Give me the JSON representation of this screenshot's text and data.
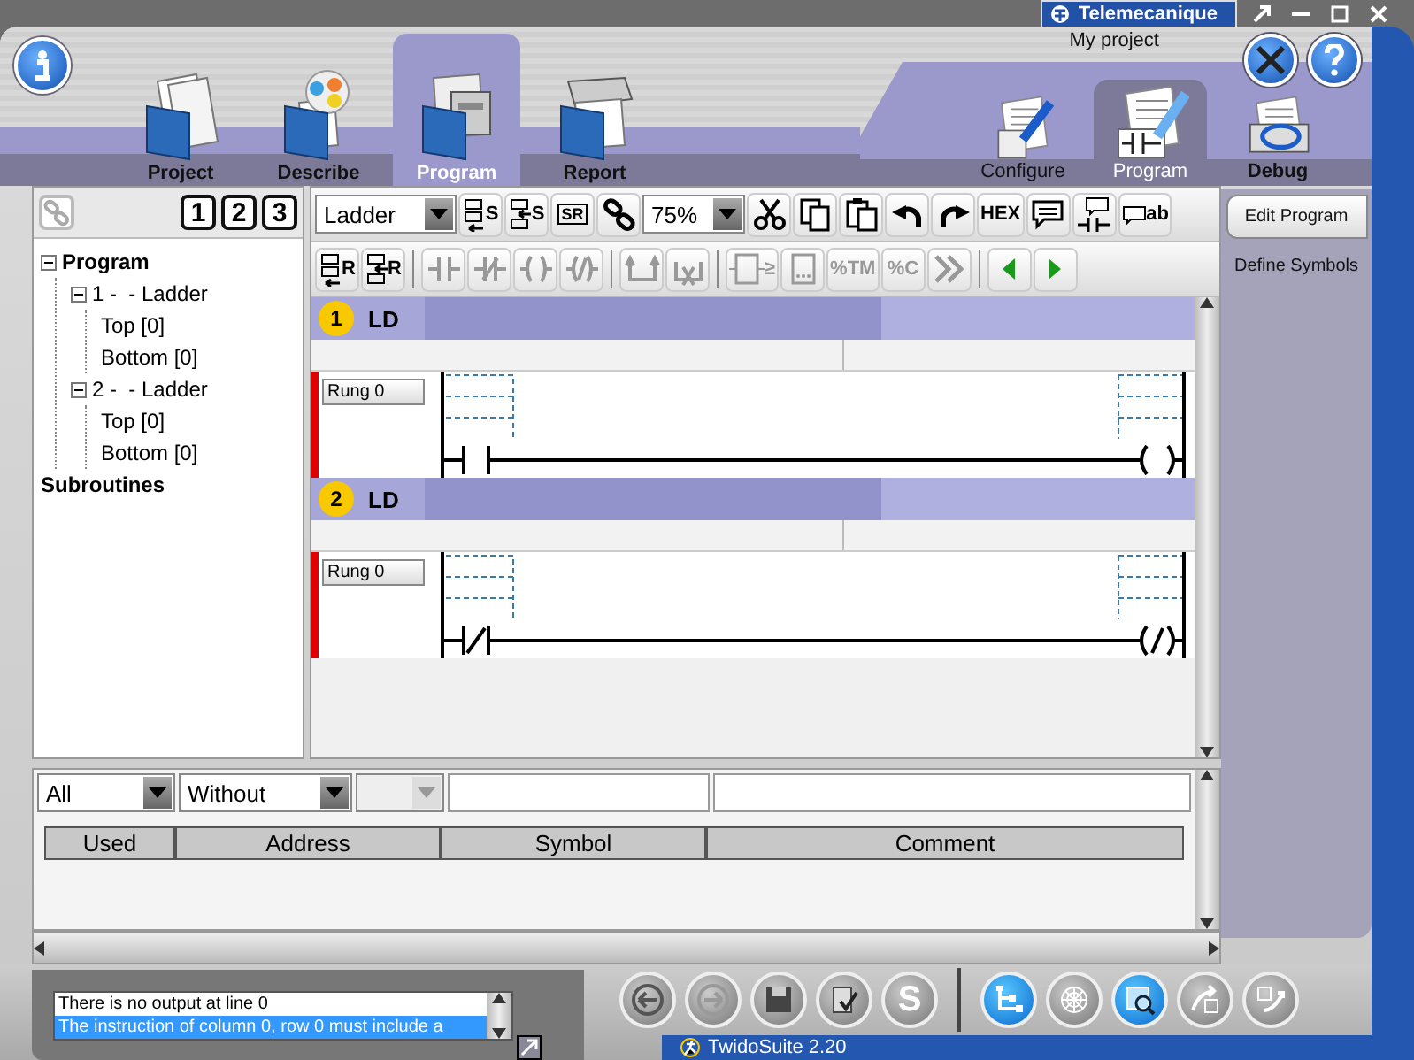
{
  "window": {
    "brand": "Telemecanique",
    "project": "My project",
    "status": "TwidoSuite 2.20"
  },
  "main_tabs": [
    {
      "label": "Project",
      "kind": "project",
      "selected": false
    },
    {
      "label": "Describe",
      "kind": "describe",
      "selected": false
    },
    {
      "label": "Program",
      "kind": "program",
      "selected": true
    },
    {
      "label": "Report",
      "kind": "report",
      "selected": false
    }
  ],
  "sub_tabs": [
    {
      "label": "Configure",
      "kind": "configure",
      "selected": false
    },
    {
      "label": "Program",
      "kind": "program",
      "selected": true
    },
    {
      "label": "Debug",
      "kind": "debug",
      "selected": false
    }
  ],
  "tree_toolbar": {
    "levels": [
      "1",
      "2",
      "3"
    ]
  },
  "tree": [
    {
      "label": "Program",
      "children": [
        {
          "label": "1 -  - Ladder",
          "children": [
            {
              "label": "Top [0]"
            },
            {
              "label": "Bottom [0]"
            }
          ]
        },
        {
          "label": "2 -  - Ladder",
          "children": [
            {
              "label": "Top [0]"
            },
            {
              "label": "Bottom [0]"
            }
          ]
        }
      ]
    },
    {
      "label": "Subroutines"
    }
  ],
  "editor": {
    "language": "Ladder",
    "zoom": "75%",
    "toolbar1": [
      {
        "kind": "insert-above",
        "label": "S",
        "disabled": false
      },
      {
        "kind": "insert-below",
        "label": "S",
        "disabled": false
      },
      {
        "kind": "sr",
        "label": "SR",
        "disabled": false
      },
      {
        "kind": "link",
        "disabled": false
      },
      {
        "kind": "zoom"
      },
      {
        "kind": "cut",
        "disabled": false
      },
      {
        "kind": "copy",
        "disabled": false
      },
      {
        "kind": "paste",
        "disabled": false
      },
      {
        "kind": "undo",
        "disabled": false
      },
      {
        "kind": "redo",
        "disabled": false
      },
      {
        "kind": "hex",
        "label": "HEX",
        "disabled": false
      },
      {
        "kind": "comment",
        "disabled": false
      },
      {
        "kind": "comment-contact",
        "disabled": false
      },
      {
        "kind": "comment-text",
        "label": "ab",
        "disabled": false
      }
    ],
    "toolbar2": [
      {
        "kind": "insert-above",
        "label": "R",
        "disabled": false
      },
      {
        "kind": "insert-below",
        "label": "R",
        "disabled": false
      },
      {
        "kind": "sep"
      },
      {
        "kind": "contact",
        "disabled": true
      },
      {
        "kind": "contact-neg",
        "disabled": true
      },
      {
        "kind": "coil",
        "disabled": true
      },
      {
        "kind": "coil-neg",
        "disabled": true
      },
      {
        "kind": "sep"
      },
      {
        "kind": "branch",
        "disabled": true
      },
      {
        "kind": "branch-delete",
        "disabled": true
      },
      {
        "kind": "sep"
      },
      {
        "kind": "compare",
        "label": "≥",
        "disabled": true
      },
      {
        "kind": "block",
        "disabled": true
      },
      {
        "kind": "text",
        "label": "%TM",
        "disabled": true
      },
      {
        "kind": "text",
        "label": "%C",
        "disabled": true
      },
      {
        "kind": "chevrons",
        "disabled": true
      },
      {
        "kind": "sep"
      },
      {
        "kind": "left",
        "disabled": false
      },
      {
        "kind": "right",
        "disabled": false
      }
    ],
    "sections": [
      {
        "number": "1",
        "label": "LD",
        "rung": "Rung 0",
        "negated": false
      },
      {
        "number": "2",
        "label": "LD",
        "rung": "Rung 0",
        "negated": true
      }
    ]
  },
  "symbols": {
    "filter": "All",
    "mode": "Without",
    "columns": [
      "Used",
      "Address",
      "Symbol",
      "Comment"
    ]
  },
  "side_panel": [
    {
      "label": "Edit Program",
      "selected": true
    },
    {
      "label": "Define Symbols",
      "selected": false
    }
  ],
  "messages": [
    {
      "text": "There is no output at line 0",
      "selected": false
    },
    {
      "text": "The instruction of column 0, row 0 must include a",
      "selected": true
    }
  ],
  "bottom_buttons": [
    {
      "kind": "back",
      "active": false
    },
    {
      "kind": "forward",
      "active": false
    },
    {
      "kind": "save",
      "active": false
    },
    {
      "kind": "check",
      "active": false
    },
    {
      "kind": "letter",
      "label": "S",
      "active": false
    },
    {
      "kind": "sep"
    },
    {
      "kind": "tree",
      "active": true
    },
    {
      "kind": "web",
      "active": false
    },
    {
      "kind": "analyze",
      "active": true
    },
    {
      "kind": "transfer-down",
      "active": false
    },
    {
      "kind": "transfer-up",
      "active": false
    }
  ]
}
